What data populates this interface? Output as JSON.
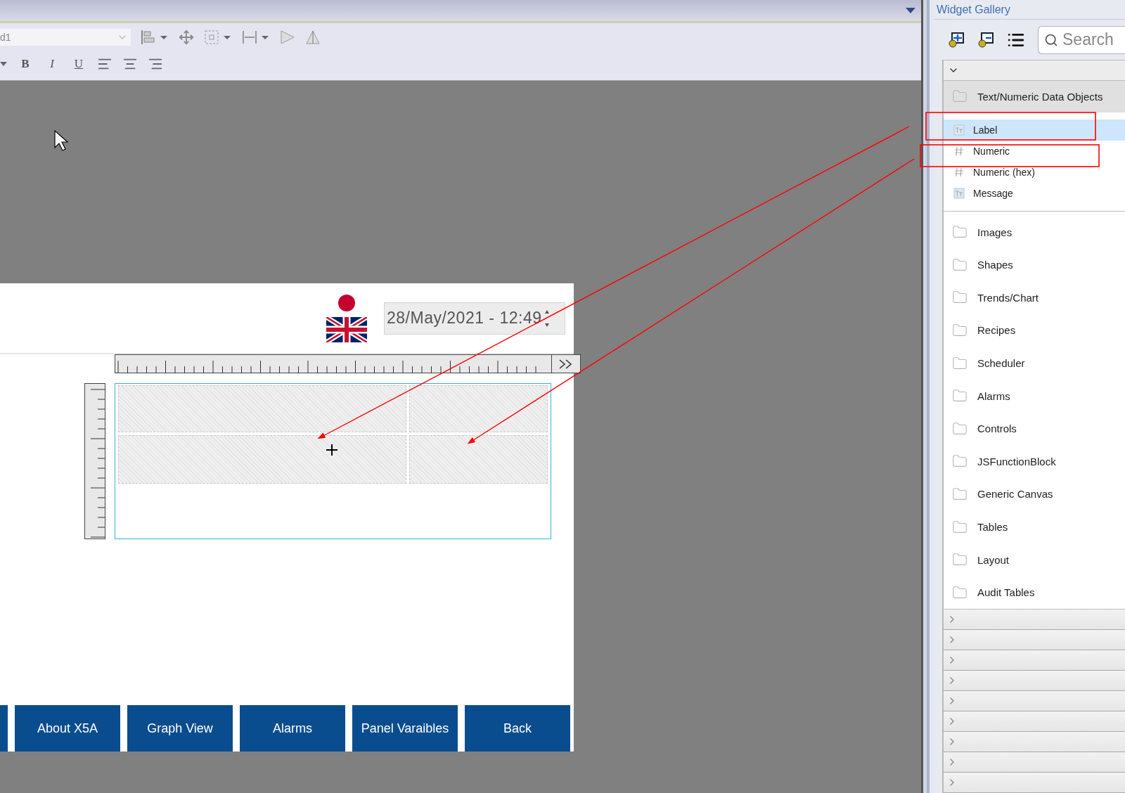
{
  "toolbar": {
    "font_field": {
      "value": "d1"
    },
    "format_buttons": [
      "B",
      "I",
      "U"
    ]
  },
  "hmi_screen": {
    "date_field": {
      "value": "28/May/2021 - 12:49"
    },
    "nav_buttons": [
      "About X5A",
      "Graph View",
      "Alarms",
      "Panel Varaibles",
      "Back"
    ]
  },
  "widget_gallery": {
    "title": "Widget Gallery",
    "search": {
      "placeholder": "Search"
    },
    "open_group": {
      "title": "Text/Numeric Data Objects",
      "items": [
        {
          "label": "Label",
          "kind": "label",
          "selected": true,
          "highlighted": true
        },
        {
          "label": "Numeric",
          "kind": "numeric",
          "selected": false,
          "highlighted": true
        },
        {
          "label": "Numeric (hex)",
          "kind": "numeric",
          "selected": false,
          "highlighted": false
        },
        {
          "label": "Message",
          "kind": "label",
          "selected": false,
          "highlighted": false
        }
      ]
    },
    "categories": [
      "Images",
      "Shapes",
      "Trends/Chart",
      "Recipes",
      "Scheduler",
      "Alarms",
      "Controls",
      "JSFunctionBlock",
      "Generic Canvas",
      "Tables",
      "Layout",
      "Audit Tables"
    ]
  }
}
